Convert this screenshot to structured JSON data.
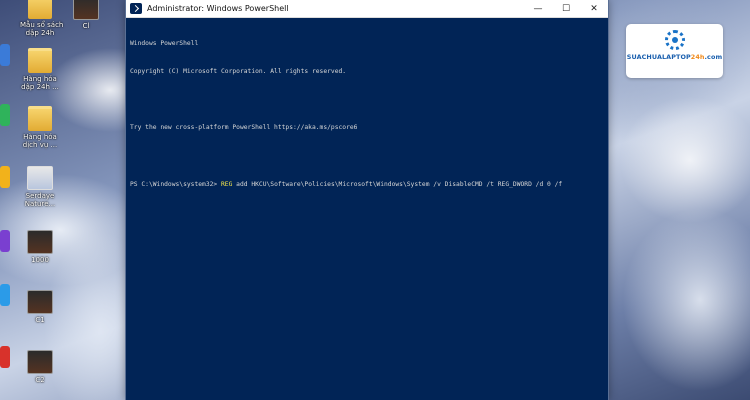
{
  "window": {
    "title": "Administrator: Windows PowerShell",
    "controls": {
      "minimize": "—",
      "maximize": "☐",
      "close": "✕"
    }
  },
  "terminal": {
    "lines": [
      "Windows PowerShell",
      "Copyright (C) Microsoft Corporation. All rights reserved.",
      "",
      "Try the new cross-platform PowerShell https://aka.ms/pscore6",
      ""
    ],
    "prompt": "PS C:\\Windows\\system32> ",
    "command_keyword": "REG",
    "command_args": " add HKCU\\Software\\Policies\\Microsoft\\Windows\\System /v DisableCMD /t REG_DWORD /d 0 /f"
  },
  "desktop_icons": [
    {
      "label": "Mẫu sổ sách\ndập 24h",
      "kind": "folder"
    },
    {
      "label": "Cl",
      "kind": "video"
    },
    {
      "label": "Hàng hóa\ndập 24h ...",
      "kind": "folder"
    },
    {
      "label": "Hàng hóa\ndịch vụ ...",
      "kind": "folder"
    },
    {
      "label": "Serdaye\nNature...",
      "kind": "photo"
    },
    {
      "label": "1000",
      "kind": "video"
    },
    {
      "label": "C1",
      "kind": "video"
    },
    {
      "label": "C2",
      "kind": "video"
    }
  ],
  "brand": {
    "text_main": "SUACHUALAPTOP",
    "text_accent": "24h",
    "text_suffix": ".com"
  },
  "colors": {
    "terminal_bg": "#012456",
    "terminal_text": "#d6d6d6",
    "command_keyword": "#f3e54b",
    "brand_blue": "#1a5fae",
    "brand_orange": "#f08a1c"
  }
}
